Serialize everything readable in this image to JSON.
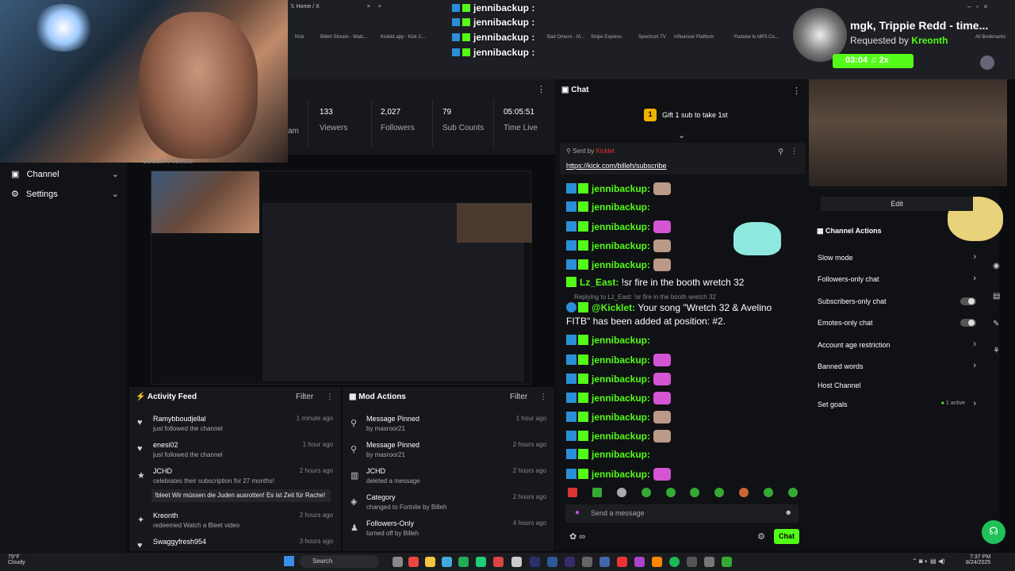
{
  "browser": {
    "tab": "Home / X",
    "bookmarks": [
      "Kick",
      "Billeh Stream - Watc...",
      "Kicklet.app - Kick C...",
      "Bad Omens - M...",
      "Stripe Express",
      "Spectrum TV",
      "Influencer Platform",
      "Youtube to MP3 Co...",
      "All Bookmarks"
    ]
  },
  "overlay": {
    "chat": [
      {
        "user": "jennibackup :"
      },
      {
        "user": "jennibackup :"
      },
      {
        "user": "jennibackup :"
      },
      {
        "user": "jennibackup :"
      }
    ],
    "now_playing": {
      "title": "mgk, Trippie Redd - time...",
      "requested_label": "Requested by",
      "requester": "Kreonth",
      "time": "03:04",
      "mult": "2x"
    }
  },
  "nav": {
    "items": [
      {
        "label": "Channel"
      },
      {
        "label": "Settings"
      }
    ]
  },
  "stats": {
    "cut_label": "am",
    "items": [
      {
        "value": "133",
        "label": "Viewers"
      },
      {
        "value": "2,027",
        "label": "Followers"
      },
      {
        "value": "79",
        "label": "Sub Counts"
      },
      {
        "value": "05:05:51",
        "label": "Time Live"
      }
    ]
  },
  "preview_label": "Stream Preview",
  "activity": {
    "title": "Activity Feed",
    "filter": "Filter",
    "items": [
      {
        "name": "Ramybboudjellal",
        "sub": "just followed the channel",
        "time": "1 minute ago",
        "icon": "heart"
      },
      {
        "name": "enesi02",
        "sub": "just followed the channel",
        "time": "1 hour ago",
        "icon": "heart"
      },
      {
        "name": "JCHD",
        "sub": "celebrates their subscription for 27 months!",
        "time": "2 hours ago",
        "icon": "star",
        "msg": "!bleet Wir müssen die Juden ausrotten! Es ist Zeit für Rache!"
      },
      {
        "name": "Kreonth",
        "sub": "redeemed Watch a Bleet video",
        "time": "2 hours ago",
        "icon": "gift"
      },
      {
        "name": "Swaggyfresh954",
        "sub": "",
        "time": "3 hours ago",
        "icon": "heart"
      }
    ]
  },
  "mod": {
    "title": "Mod Actions",
    "filter": "Filter",
    "items": [
      {
        "name": "Message Pinned",
        "sub": "by masroor21",
        "time": "1 hour ago",
        "icon": "pin"
      },
      {
        "name": "Message Pinned",
        "sub": "by masroor21",
        "time": "2 hours ago",
        "icon": "pin"
      },
      {
        "name": "JCHD",
        "sub": "deleted a message",
        "time": "2 hours ago",
        "icon": "trash"
      },
      {
        "name": "Category",
        "sub": "changed to Fortnite by Billeh",
        "time": "2 hours ago",
        "icon": "tag"
      },
      {
        "name": "Followers-Only",
        "sub": "turned off by Billeh",
        "time": "4 hours ago",
        "icon": "users"
      }
    ]
  },
  "chat": {
    "title": "Chat",
    "gift": "Gift 1 sub to take 1st",
    "gift_count": "1",
    "pinned_sent": "Sent by",
    "pinned_by": "Kicklet",
    "pinned_link": "https://kick.com/billeh/subscribe",
    "lines": [
      {
        "user": "jennibackup:",
        "emote": "#bb9988"
      },
      {
        "user": "jennibackup:",
        "emote": ""
      },
      {
        "user": "jennibackup:",
        "emote": "#d455d4"
      },
      {
        "user": "jennibackup:",
        "emote": "#bb9988"
      },
      {
        "user": "jennibackup:",
        "emote": "#bb9988"
      }
    ],
    "lz_user": "Lz_East:",
    "lz_msg": "!sr fire in the booth wretch 32",
    "reply": "Replying to Lz_East: !sr fire in the booth wretch 32",
    "bot": "@Kicklet:",
    "bot_msg": "Your song \"Wretch 32 & Avelino",
    "bot_msg2": "FITB\" has been added at position: #2.",
    "lines2": [
      {
        "user": "jennibackup:",
        "emote": ""
      },
      {
        "user": "jennibackup:",
        "emote": "#d455d4"
      },
      {
        "user": "jennibackup:",
        "emote": "#d455d4"
      },
      {
        "user": "jennibackup:",
        "emote": "#d455d4"
      },
      {
        "user": "jennibackup:",
        "emote": "#bb9988"
      },
      {
        "user": "jennibackup:",
        "emote": "#bb9988"
      },
      {
        "user": "jennibackup:",
        "emote": ""
      },
      {
        "user": "jennibackup:",
        "emote": "#d455d4"
      }
    ],
    "placeholder": "Send a message",
    "send": "Chat"
  },
  "actions": {
    "edit": "Edit",
    "title": "Channel Actions",
    "items": [
      {
        "label": "Slow mode",
        "ctl": "arrow"
      },
      {
        "label": "Followers-only chat",
        "ctl": "arrow"
      },
      {
        "label": "Subscribers-only chat",
        "ctl": "toggle"
      },
      {
        "label": "Emotes-only chat",
        "ctl": "toggle"
      },
      {
        "label": "Account age restriction",
        "ctl": "arrow"
      },
      {
        "label": "Banned words",
        "ctl": "arrow"
      },
      {
        "label": "Host Channel",
        "ctl": "none"
      },
      {
        "label": "Set goals",
        "ctl": "arrow",
        "badge": "1 active"
      }
    ]
  },
  "taskbar": {
    "temp": "79°F",
    "weather": "Cloudy",
    "search": "Search",
    "time": "7:37 PM",
    "date": "8/24/2025"
  }
}
